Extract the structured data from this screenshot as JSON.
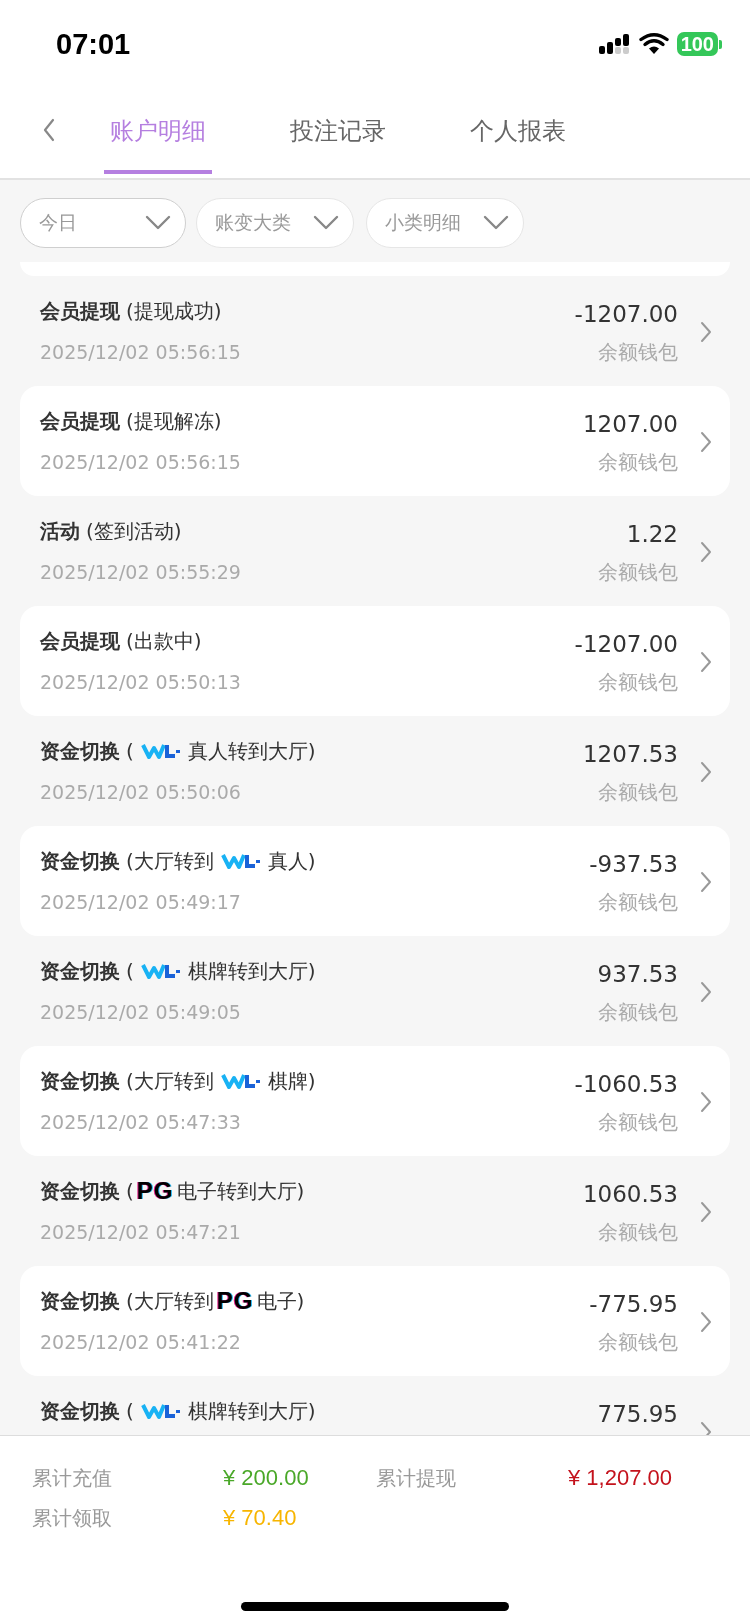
{
  "status_bar": {
    "time": "07:01",
    "battery": "100"
  },
  "tabs": [
    {
      "label": "账户明细",
      "selected": true
    },
    {
      "label": "投注记录",
      "selected": false
    },
    {
      "label": "个人报表",
      "selected": false
    }
  ],
  "filters": [
    {
      "label": "今日"
    },
    {
      "label": "账变大类"
    },
    {
      "label": "小类明细"
    }
  ],
  "records": [
    {
      "category": "会员提现",
      "detail": [
        {
          "kind": "text",
          "text": "(提现成功)"
        }
      ],
      "time": "2025/12/02 05:56:15",
      "amount": "-1207.00",
      "wallet": "余额钱包"
    },
    {
      "category": "会员提现",
      "detail": [
        {
          "kind": "text",
          "text": "(提现解冻)"
        }
      ],
      "time": "2025/12/02 05:56:15",
      "amount": "1207.00",
      "wallet": "余额钱包"
    },
    {
      "category": "活动",
      "detail": [
        {
          "kind": "text",
          "text": "(签到活动)"
        }
      ],
      "time": "2025/12/02 05:55:29",
      "amount": "1.22",
      "wallet": "余额钱包"
    },
    {
      "category": "会员提现",
      "detail": [
        {
          "kind": "text",
          "text": "(出款中)"
        }
      ],
      "time": "2025/12/02 05:50:13",
      "amount": "-1207.00",
      "wallet": "余额钱包"
    },
    {
      "category": "资金切换",
      "detail": [
        {
          "kind": "text",
          "text": "("
        },
        {
          "kind": "wave-logo"
        },
        {
          "kind": "text",
          "text": "真人转到大厅)"
        }
      ],
      "time": "2025/12/02 05:50:06",
      "amount": "1207.53",
      "wallet": "余额钱包"
    },
    {
      "category": "资金切换",
      "detail": [
        {
          "kind": "text",
          "text": "(大厅转到"
        },
        {
          "kind": "wave-logo"
        },
        {
          "kind": "text",
          "text": "真人)"
        }
      ],
      "time": "2025/12/02 05:49:17",
      "amount": "-937.53",
      "wallet": "余额钱包"
    },
    {
      "category": "资金切换",
      "detail": [
        {
          "kind": "text",
          "text": "("
        },
        {
          "kind": "wave-logo"
        },
        {
          "kind": "text",
          "text": "棋牌转到大厅)"
        }
      ],
      "time": "2025/12/02 05:49:05",
      "amount": "937.53",
      "wallet": "余额钱包"
    },
    {
      "category": "资金切换",
      "detail": [
        {
          "kind": "text",
          "text": "(大厅转到"
        },
        {
          "kind": "wave-logo"
        },
        {
          "kind": "text",
          "text": "棋牌)"
        }
      ],
      "time": "2025/12/02 05:47:33",
      "amount": "-1060.53",
      "wallet": "余额钱包"
    },
    {
      "category": "资金切换",
      "detail": [
        {
          "kind": "text",
          "text": "("
        },
        {
          "kind": "logo-text",
          "text": "PG"
        },
        {
          "kind": "text",
          "text": "电子转到大厅)"
        }
      ],
      "time": "2025/12/02 05:47:21",
      "amount": "1060.53",
      "wallet": "余额钱包"
    },
    {
      "category": "资金切换",
      "detail": [
        {
          "kind": "text",
          "text": "(大厅转到"
        },
        {
          "kind": "logo-text",
          "text": "PG"
        },
        {
          "kind": "text",
          "text": "电子)"
        }
      ],
      "time": "2025/12/02 05:41:22",
      "amount": "-775.95",
      "wallet": "余额钱包"
    },
    {
      "category": "资金切换",
      "detail": [
        {
          "kind": "text",
          "text": "("
        },
        {
          "kind": "wave-logo"
        },
        {
          "kind": "text",
          "text": "棋牌转到大厅)"
        }
      ],
      "amount": "775.95"
    }
  ],
  "summary": [
    {
      "label": "累计充值",
      "value": "¥ 200.00",
      "color": "#4aa829"
    },
    {
      "label": "累计提现",
      "value": "¥ 1,207.00",
      "color": "#c4121c"
    },
    {
      "label": "累计领取",
      "value": "¥ 70.40",
      "color": "#f7b500"
    }
  ]
}
